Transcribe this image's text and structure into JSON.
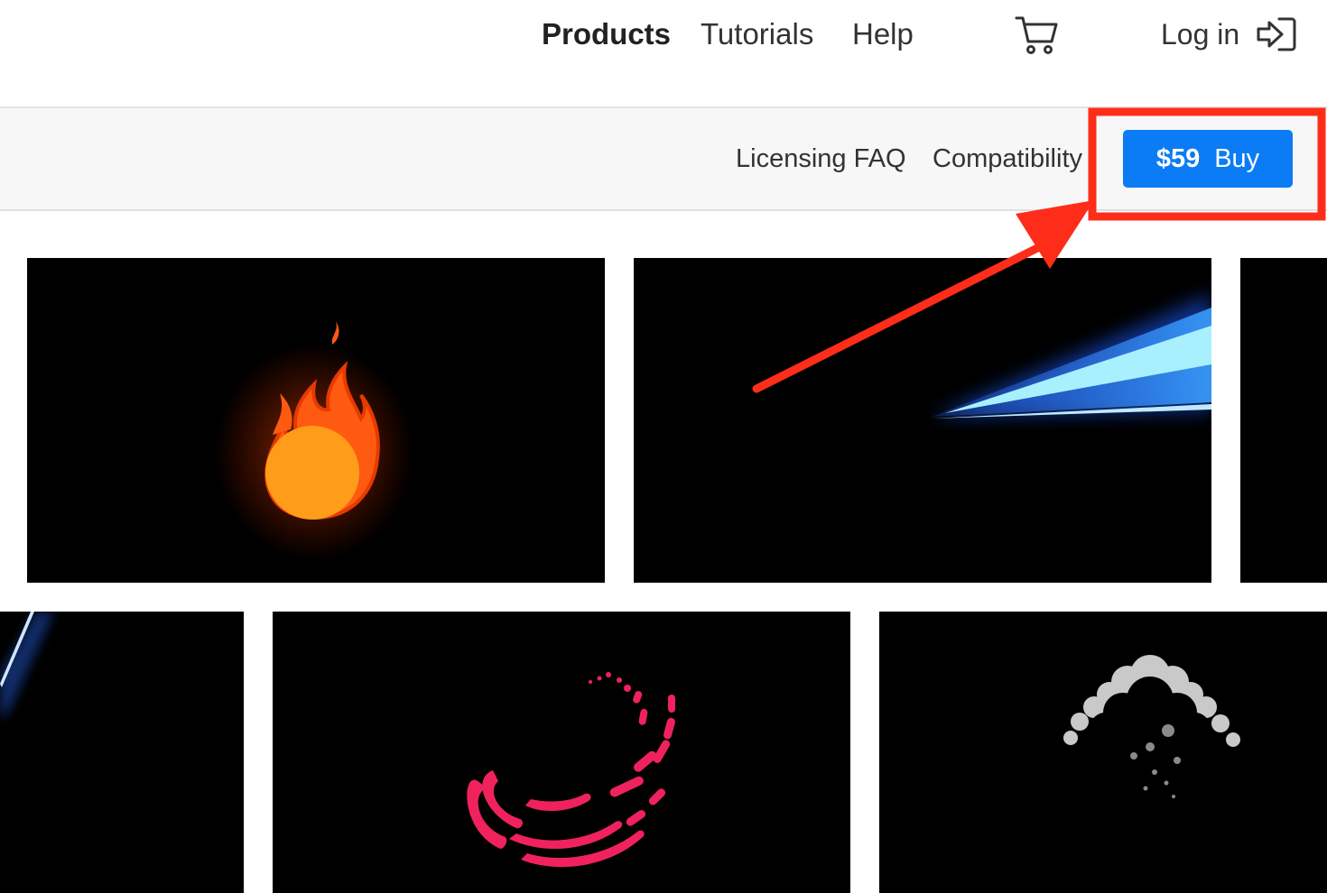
{
  "nav": {
    "products": "Products",
    "tutorials": "Tutorials",
    "help": "Help",
    "login": "Log in",
    "cart_icon": "shopping-cart-icon",
    "login_icon": "login-arrow-icon"
  },
  "subnav": {
    "licensing_faq": "Licensing FAQ",
    "compatibility": "Compatibility",
    "buy": {
      "price": "$59",
      "label": "Buy"
    }
  },
  "colors": {
    "accent_blue": "#0b7cf5",
    "annotation_red": "#fd2d1a"
  },
  "gallery": [
    {
      "effect": "fire"
    },
    {
      "effect": "energy-beam"
    },
    {
      "effect": "partial"
    },
    {
      "effect": "light-streak"
    },
    {
      "effect": "pink-swirl"
    },
    {
      "effect": "smoke-cloud"
    }
  ]
}
